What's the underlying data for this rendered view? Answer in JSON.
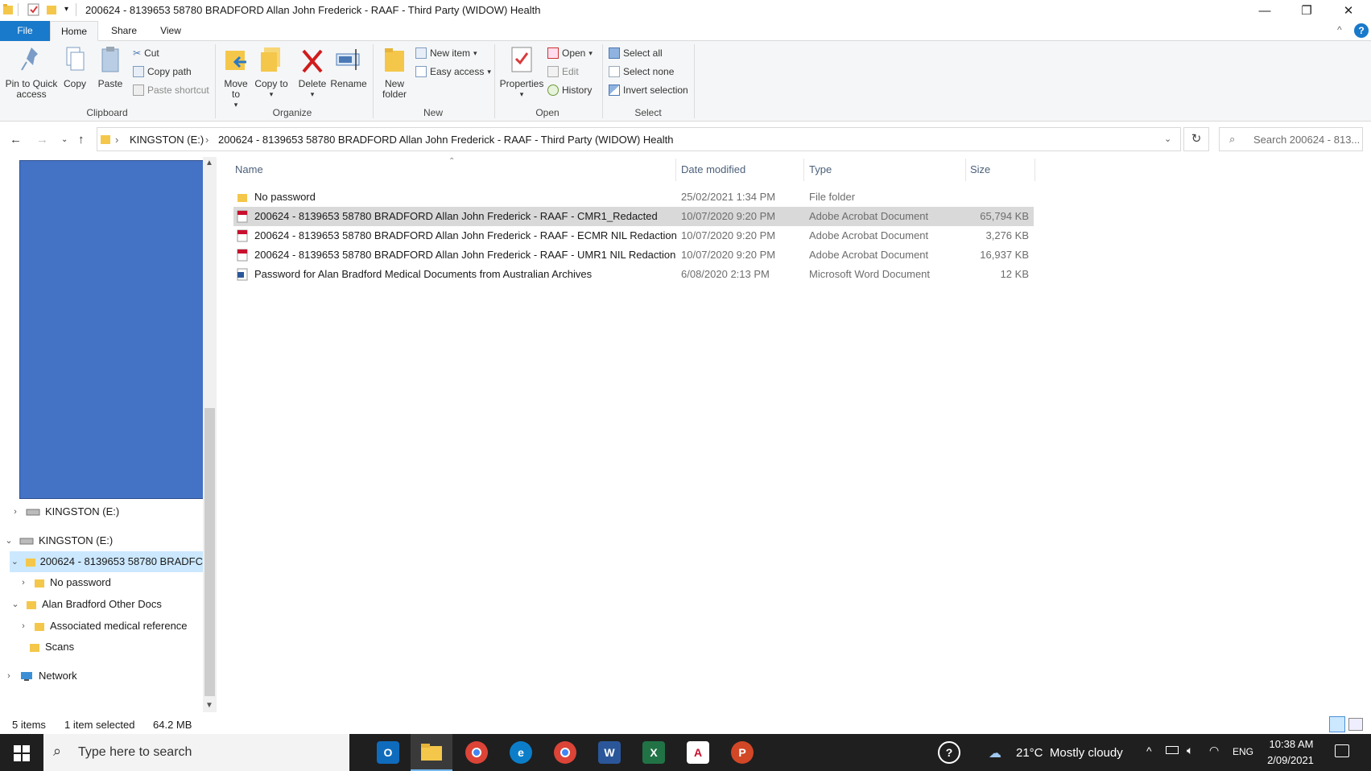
{
  "window": {
    "title": "200624 - 8139653 58780 BRADFORD Allan John Frederick - RAAF - Third Party (WIDOW) Health",
    "minimize_glyph": "—",
    "maximize_glyph": "❐",
    "close_glyph": "✕",
    "help_glyph": "?"
  },
  "tabs": {
    "file": "File",
    "home": "Home",
    "share": "Share",
    "view": "View"
  },
  "ribbon": {
    "pin": "Pin to Quick access",
    "copy": "Copy",
    "paste": "Paste",
    "cut": "Cut",
    "copy_path": "Copy path",
    "paste_shortcut": "Paste shortcut",
    "group_clipboard": "Clipboard",
    "move_to": "Move to",
    "copy_to": "Copy to",
    "delete": "Delete",
    "rename": "Rename",
    "group_organize": "Organize",
    "new_folder": "New folder",
    "new_item": "New item",
    "easy_access": "Easy access",
    "group_new": "New",
    "properties": "Properties",
    "open": "Open",
    "edit": "Edit",
    "history": "History",
    "group_open": "Open",
    "select_all": "Select all",
    "select_none": "Select none",
    "invert_selection": "Invert selection",
    "group_select": "Select"
  },
  "address": {
    "drive": "KINGSTON (E:)",
    "folder": "200624 - 8139653 58780 BRADFORD Allan John Frederick - RAAF - Third Party (WIDOW) Health",
    "search_placeholder": "Search 200624 - 813..."
  },
  "nav": {
    "items": [
      {
        "label": "KINGSTON (E:)"
      },
      {
        "label": "KINGSTON (E:)"
      },
      {
        "label": "200624 - 8139653 58780 BRADFC"
      },
      {
        "label": "No password"
      },
      {
        "label": "Alan Bradford Other Docs"
      },
      {
        "label": "Associated medical reference"
      },
      {
        "label": "Scans"
      },
      {
        "label": "Network"
      }
    ]
  },
  "columns": {
    "name": "Name",
    "date": "Date modified",
    "type": "Type",
    "size": "Size"
  },
  "files": [
    {
      "name": "No password",
      "date": "25/02/2021 1:34 PM",
      "type": "File folder",
      "size": "",
      "icon": "folder-icon"
    },
    {
      "name": "200624 - 8139653 58780 BRADFORD Allan John Frederick - RAAF - CMR1_Redacted",
      "date": "10/07/2020 9:20 PM",
      "type": "Adobe Acrobat Document",
      "size": "65,794 KB",
      "icon": "pdf-icon"
    },
    {
      "name": "200624 - 8139653 58780 BRADFORD Allan John Frederick - RAAF - ECMR NIL Redaction",
      "date": "10/07/2020 9:20 PM",
      "type": "Adobe Acrobat Document",
      "size": "3,276 KB",
      "icon": "pdf-icon"
    },
    {
      "name": "200624 - 8139653 58780 BRADFORD Allan John Frederick - RAAF - UMR1 NIL Redaction",
      "date": "10/07/2020 9:20 PM",
      "type": "Adobe Acrobat Document",
      "size": "16,937 KB",
      "icon": "pdf-icon"
    },
    {
      "name": "Password for Alan Bradford Medical Documents from Australian Archives",
      "date": "6/08/2020 2:13 PM",
      "type": "Microsoft Word Document",
      "size": "12 KB",
      "icon": "word-doc-icon"
    }
  ],
  "status": {
    "items": "5 items",
    "selected": "1 item selected",
    "size": "64.2 MB"
  },
  "taskbar": {
    "search_placeholder": "Type here to search",
    "weather": "21°C  Mostly cloudy",
    "lang": "ENG",
    "time": "10:38 AM",
    "date": "2/09/2021"
  },
  "colors": {
    "accent": "#1979ca",
    "selection": "#cce8ff",
    "redacted_block": "#4472c4"
  }
}
